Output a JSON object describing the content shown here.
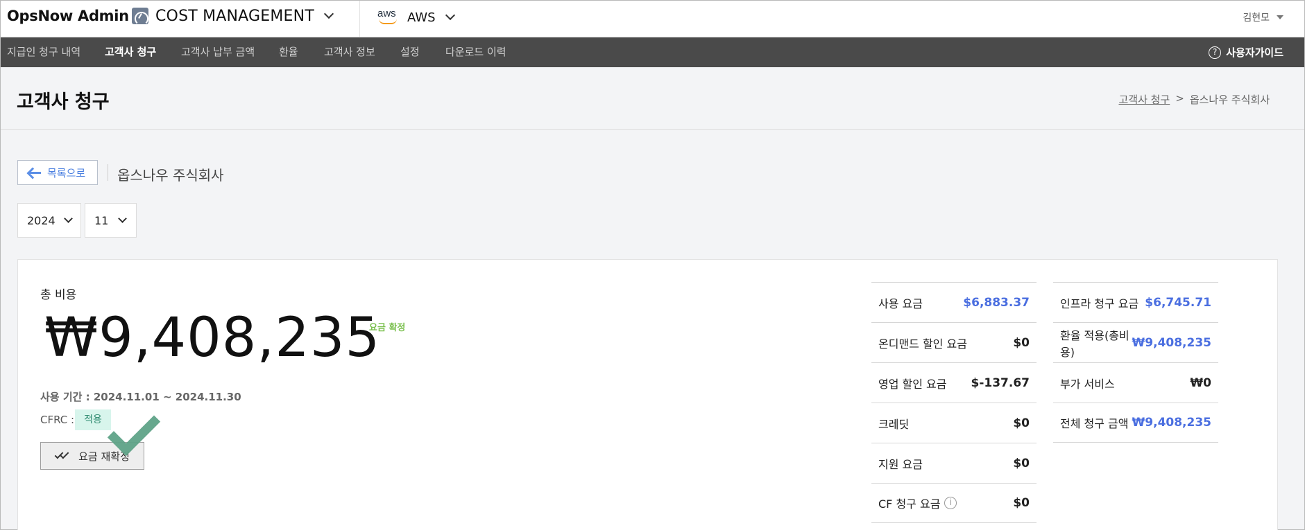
{
  "header": {
    "brand": "OpsNow Admin",
    "product": "COST MANAGEMENT",
    "cloud_logo_text": "aws",
    "cloud": "AWS",
    "user": "김현모"
  },
  "nav": {
    "items": [
      {
        "label": "지급인 청구 내역",
        "active": false
      },
      {
        "label": "고객사 청구",
        "active": true
      },
      {
        "label": "고객사 납부 금액",
        "active": false
      },
      {
        "label": "환율",
        "active": false
      },
      {
        "label": "고객사 정보",
        "active": false
      },
      {
        "label": "설정",
        "active": false
      },
      {
        "label": "다운로드 이력",
        "active": false
      }
    ],
    "guide": "사용자가이드",
    "guide_icon_glyph": "?"
  },
  "page": {
    "title": "고객사 청구",
    "breadcrumb": {
      "link": "고객사 청구",
      "sep": ">",
      "current": "옵스나우 주식회사"
    }
  },
  "back_label": "목록으로",
  "company": "옵스나우 주식회사",
  "filters": {
    "year": "2024",
    "month": "11"
  },
  "summary": {
    "total_label": "총 비용",
    "total_amount": "₩9,408,235",
    "status": "요금 확정",
    "period": "사용 기간 : 2024.11.01 ~ 2024.11.30",
    "cfrc_label": "CFRC :",
    "cfrc_value": "적용",
    "reconfirm_label": "요금 재확정"
  },
  "fees_left": [
    {
      "label": "사용 요금",
      "value": "$6,883.37",
      "highlight": true
    },
    {
      "label": "온디맨드 할인 요금",
      "value": "$0",
      "highlight": false
    },
    {
      "label": "영업 할인 요금",
      "value": "$-137.67",
      "highlight": false
    },
    {
      "label": "크레딧",
      "value": "$0",
      "highlight": false
    },
    {
      "label": "지원 요금",
      "value": "$0",
      "highlight": false
    },
    {
      "label": "CF 청구 요금",
      "value": "$0",
      "highlight": false,
      "info_glyph": "i"
    }
  ],
  "fees_right": [
    {
      "label": "인프라 청구 요금",
      "value": "$6,745.71",
      "highlight": true
    },
    {
      "label": "환율 적용(총비용)",
      "value": "₩9,408,235",
      "highlight": true
    },
    {
      "label": "부가 서비스",
      "value": "₩0",
      "highlight": false
    },
    {
      "label": "전체 청구 금액",
      "value": "₩9,408,235",
      "highlight": true
    }
  ],
  "colors": {
    "accent": "#4a6ee0",
    "nav_bg": "#4a4a4a",
    "confirmed": "#7bc04f",
    "badge_bg": "#d8f5ec"
  }
}
